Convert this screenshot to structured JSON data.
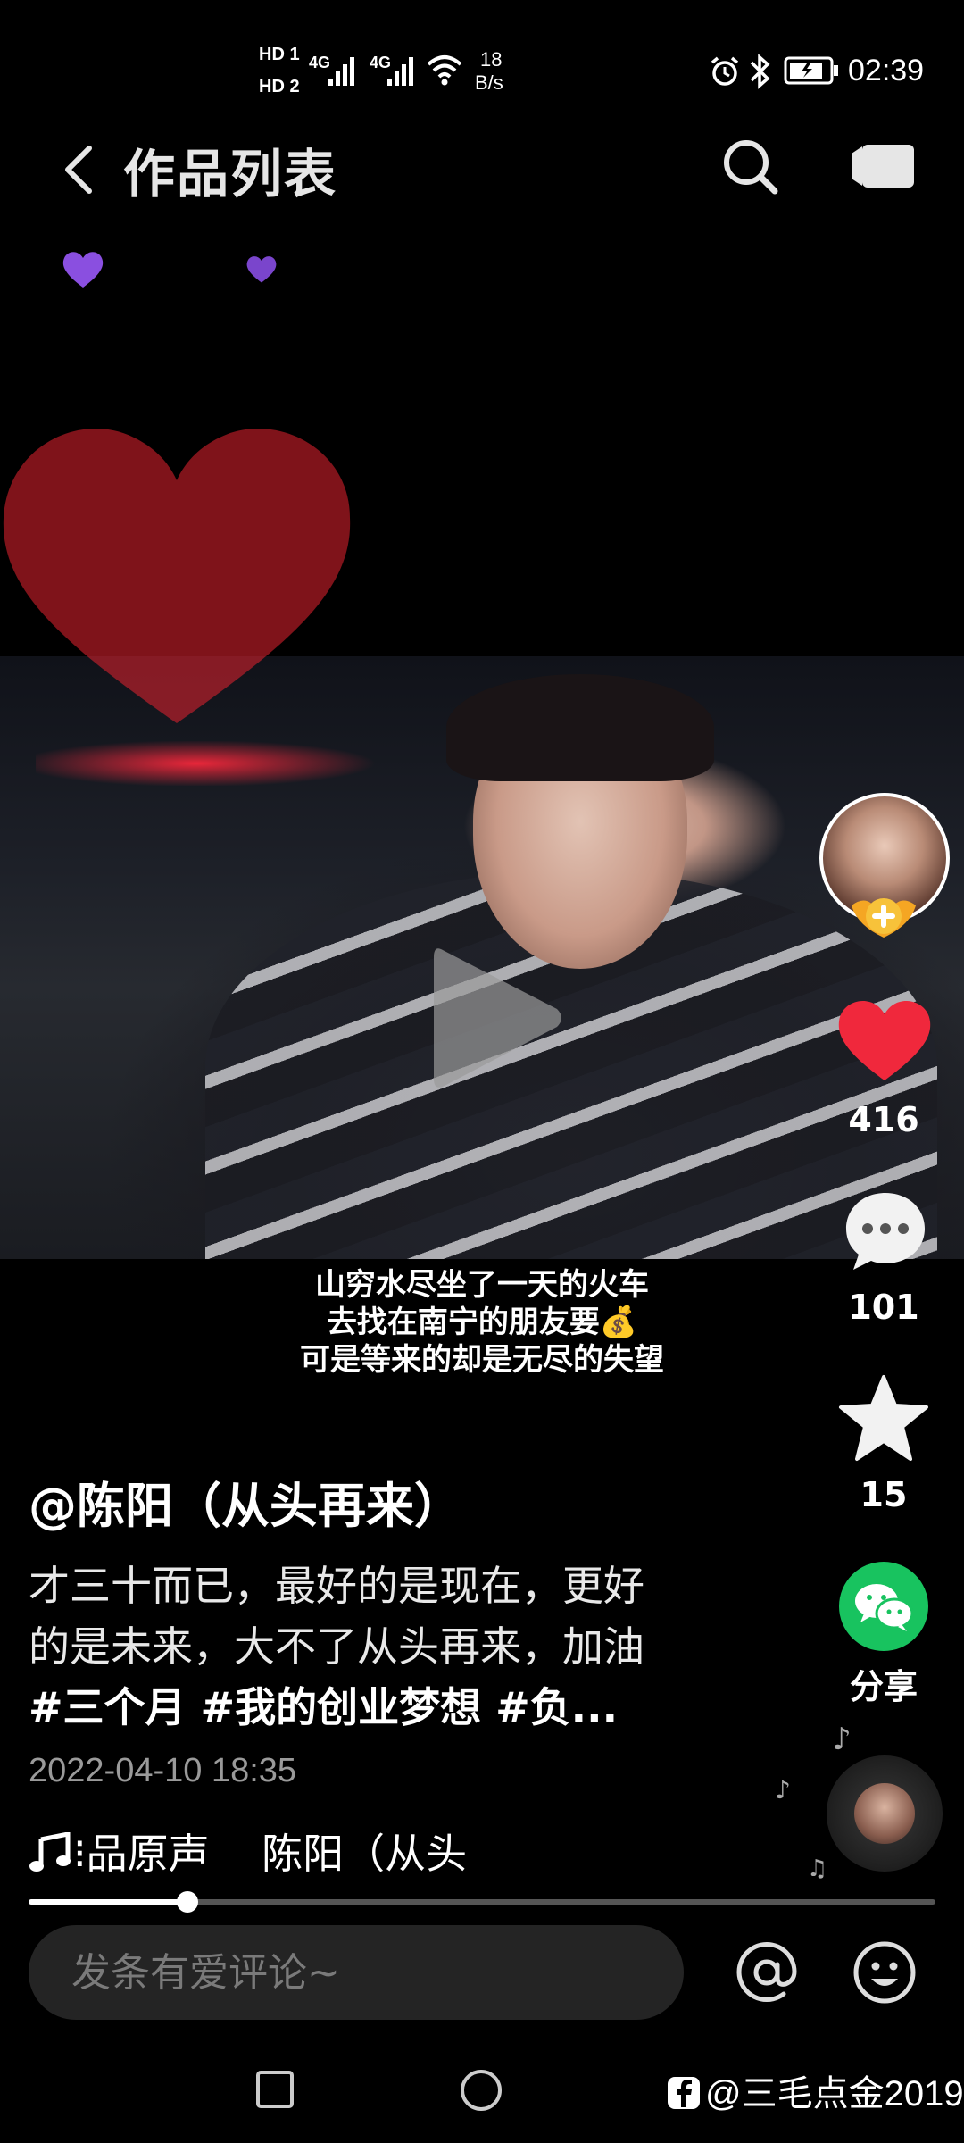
{
  "status_bar": {
    "hd1": "HD 1",
    "hd2": "HD 2",
    "net1": "4G",
    "net2": "4G",
    "speed_value": "18",
    "speed_unit": "B/s",
    "time": "02:39"
  },
  "header": {
    "title": "作品列表"
  },
  "video": {
    "caption_lines": [
      "山穷水尽坐了一天的火车",
      "去找在南宁的朋友要💰",
      "可是等来的却是无尽的失望"
    ]
  },
  "sidebar": {
    "like_count": "416",
    "comment_count": "101",
    "favorite_count": "15",
    "share_label": "分享"
  },
  "post": {
    "author": "@陈阳（从头再来）",
    "description_line1": "才三十而已，最好的是现在，更好",
    "description_line2": "的是未来，大不了从头再来，加油",
    "tags": "#三个月 #我的创业梦想 #负...",
    "date": "2022-04-10 18:35",
    "music": "⁝品原声    陈阳（从头"
  },
  "playback": {
    "progress_fraction": 0.175
  },
  "comment_bar": {
    "placeholder": "发条有爱评论~"
  },
  "watermark": "@三毛点金2019",
  "colors": {
    "like_red": "#f0283c",
    "share_green": "#18c35f",
    "purple_heart": "#8a4fe0"
  }
}
